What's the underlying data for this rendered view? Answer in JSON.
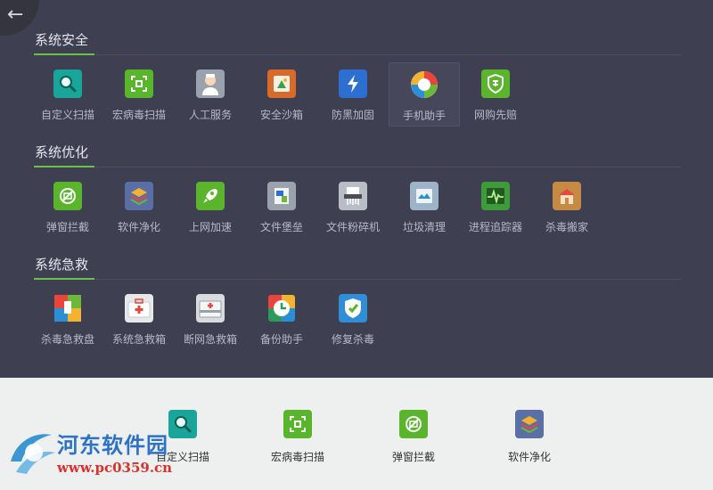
{
  "back": {
    "icon": "arrow-left-icon",
    "glyph": "←"
  },
  "sections": [
    {
      "title": "系统安全",
      "items": [
        {
          "label": "自定义扫描",
          "icon": "magnifier-icon",
          "color": "#1aa59a"
        },
        {
          "label": "宏病毒扫描",
          "icon": "virus-scan-icon",
          "color": "#58b62a"
        },
        {
          "label": "人工服务",
          "icon": "doctor-icon",
          "color": "#9aa3ad"
        },
        {
          "label": "安全沙箱",
          "icon": "sandbox-icon",
          "color": "#d86a2b"
        },
        {
          "label": "防黑加固",
          "icon": "lightning-shield-icon",
          "color": "#2d6fd0"
        },
        {
          "label": "手机助手",
          "icon": "phone-assistant-icon",
          "color": "#e9453b"
        },
        {
          "label": "网购先赔",
          "icon": "shopping-shield-icon",
          "color": "#5ab52c"
        }
      ]
    },
    {
      "title": "系统优化",
      "items": [
        {
          "label": "弹窗拦截",
          "icon": "popup-block-icon",
          "color": "#5ab52c"
        },
        {
          "label": "软件净化",
          "icon": "layers-icon",
          "color": "#5a6fa6"
        },
        {
          "label": "上网加速",
          "icon": "rocket-icon",
          "color": "#5ab52c"
        },
        {
          "label": "文件堡垒",
          "icon": "file-fortress-icon",
          "color": "#9aa3ad"
        },
        {
          "label": "文件粉碎机",
          "icon": "shredder-icon",
          "color": "#b9bec6"
        },
        {
          "label": "垃圾清理",
          "icon": "cleanup-icon",
          "color": "#9db3c7"
        },
        {
          "label": "进程追踪器",
          "icon": "process-tracker-icon",
          "color": "#3f9b3a"
        },
        {
          "label": "杀毒搬家",
          "icon": "house-move-icon",
          "color": "#c58b44"
        }
      ]
    },
    {
      "title": "系统急救",
      "items": [
        {
          "label": "杀毒急救盘",
          "icon": "rescue-disk-icon",
          "color": "#e9453b"
        },
        {
          "label": "系统急救箱",
          "icon": "first-aid-kit-icon",
          "color": "#e7e8ea"
        },
        {
          "label": "断网急救箱",
          "icon": "offline-aid-kit-icon",
          "color": "#d9dbdf"
        },
        {
          "label": "备份助手",
          "icon": "backup-icon",
          "color": "#2b9a5a"
        },
        {
          "label": "修复杀毒",
          "icon": "repair-shield-icon",
          "color": "#2f8ed7"
        }
      ]
    }
  ],
  "tray": [
    {
      "label": "自定义扫描",
      "icon": "magnifier-icon"
    },
    {
      "label": "宏病毒扫描",
      "icon": "virus-scan-icon"
    },
    {
      "label": "弹窗拦截",
      "icon": "popup-block-icon"
    },
    {
      "label": "软件净化",
      "icon": "layers-icon"
    }
  ],
  "watermark": {
    "name": "河东软件园",
    "url": "www.pc0359.cn"
  }
}
